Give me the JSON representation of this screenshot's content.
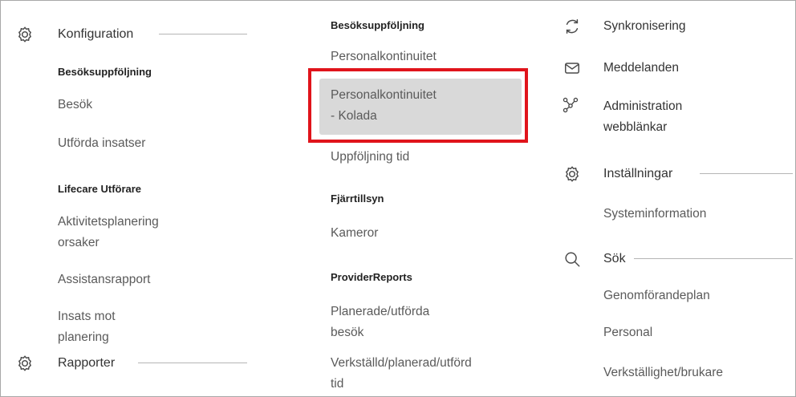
{
  "col1": {
    "konfiguration": "Konfiguration",
    "besok_group": "Besöksuppföljning",
    "besok": "Besök",
    "utforda": "Utförda insatser",
    "lifecare_group": "Lifecare Utförare",
    "aktivitet_l1": "Aktivitetsplanering",
    "aktivitet_l2": "orsaker",
    "assistans": "Assistansrapport",
    "insats_l1": "Insats mot",
    "insats_l2": "planering",
    "rapporter": "Rapporter"
  },
  "col2": {
    "besok_group": "Besöksuppföljning",
    "personalkont": "Personalkontinuitet",
    "kolada_l1": "Personalkontinuitet",
    "kolada_l2": "- Kolada",
    "uppfoljning": "Uppföljning tid",
    "fjarr_group": "Fjärrtillsyn",
    "kameror": "Kameror",
    "provider_group": "ProviderReports",
    "planerade_l1": "Planerade/utförda",
    "planerade_l2": "besök",
    "verkstalld_l1": "Verkställd/planerad/utförd",
    "verkstalld_l2": "tid"
  },
  "col3": {
    "synk": "Synkronisering",
    "meddelanden": "Meddelanden",
    "admin_l1": "Administration",
    "admin_l2": "webblänkar",
    "installningar": "Inställningar",
    "systeminfo": "Systeminformation",
    "sok": "Sök",
    "genomforande": "Genomförandeplan",
    "personal": "Personal",
    "verkstallighet": "Verkställighet/brukare"
  },
  "colors": {
    "highlight": "#e0141b",
    "selected_bg": "#d9d9d9"
  },
  "icons": [
    "gear-icon",
    "sync-icon",
    "mail-icon",
    "network-icon",
    "search-icon"
  ]
}
